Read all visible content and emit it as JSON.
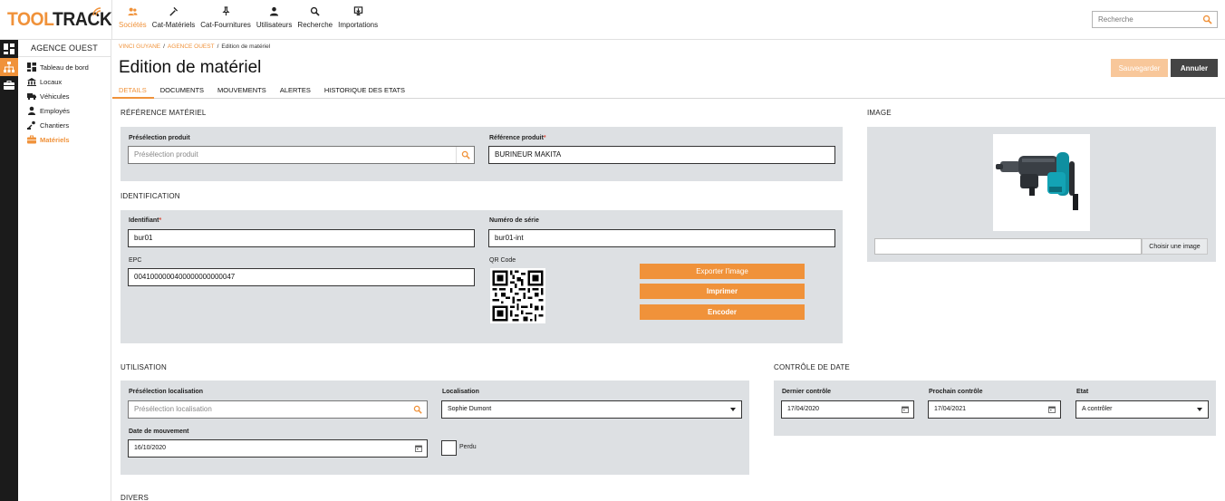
{
  "brand": {
    "part1": "TOOL",
    "part2": "TRACK",
    "accent": "#f0923a"
  },
  "nav": [
    {
      "label": "Sociétés",
      "icon": "users-icon",
      "active": true
    },
    {
      "label": "Cat-Matériels",
      "icon": "hammer-icon"
    },
    {
      "label": "Cat-Fournitures",
      "icon": "pin-icon"
    },
    {
      "label": "Utilisateurs",
      "icon": "user-icon"
    },
    {
      "label": "Recherche",
      "icon": "search-icon"
    },
    {
      "label": "Importations",
      "icon": "import-icon"
    }
  ],
  "search": {
    "placeholder": "Recherche"
  },
  "sidebar": {
    "agency": "AGENCE OUEST",
    "items": [
      {
        "label": "Tableau de bord",
        "icon": "dashboard-icon"
      },
      {
        "label": "Locaux",
        "icon": "building-icon"
      },
      {
        "label": "Véhicules",
        "icon": "truck-icon"
      },
      {
        "label": "Employés",
        "icon": "person-icon"
      },
      {
        "label": "Chantiers",
        "icon": "worksite-icon"
      },
      {
        "label": "Matériels",
        "icon": "toolbox-icon",
        "active": true
      }
    ]
  },
  "breadcrumb": {
    "company": "VINCI GUYANE",
    "agency": "AGENCE OUEST",
    "current": "Edition de matériel"
  },
  "page": {
    "title": "Edition de matériel",
    "save_label": "Sauvegarder",
    "cancel_label": "Annuler"
  },
  "tabs": [
    "DETAILS",
    "DOCUMENTS",
    "MOUVEMENTS",
    "ALERTES",
    "HISTORIQUE DES ETATS"
  ],
  "reference": {
    "title": "RÉFÉRENCE MATÉRIEL",
    "preselection_label": "Présélection produit",
    "preselection_placeholder": "Présélection produit",
    "product_ref_label": "Référence produit",
    "product_ref_value": "BURINEUR MAKITA"
  },
  "identification": {
    "title": "IDENTIFICATION",
    "id_label": "Identifiant",
    "id_value": "bur01",
    "serial_label": "Numéro de série",
    "serial_value": "bur01-int",
    "epc_label": "EPC",
    "epc_value": "0041000000400000000000047",
    "qr_label": "QR Code",
    "export_label": "Exporter l'image",
    "print_label": "Imprimer",
    "encode_label": "Encoder"
  },
  "image": {
    "title": "IMAGE",
    "choose_label": "Choisir une image"
  },
  "usage": {
    "title": "UTILISATION",
    "loc_preselection_label": "Présélection localisation",
    "loc_preselection_placeholder": "Présélection localisation",
    "location_label": "Localisation",
    "location_value": "Sophie Dumont",
    "move_date_label": "Date de mouvement",
    "move_date_value": "16/10/2020",
    "lost_label": "Perdu"
  },
  "date_control": {
    "title": "CONTRÔLE DE DATE",
    "last_label": "Dernier contrôle",
    "last_value": "17/04/2020",
    "next_label": "Prochain contrôle",
    "next_value": "17/04/2021",
    "state_label": "Etat",
    "state_value": "A contrôler"
  },
  "misc": {
    "title": "DIVERS"
  }
}
